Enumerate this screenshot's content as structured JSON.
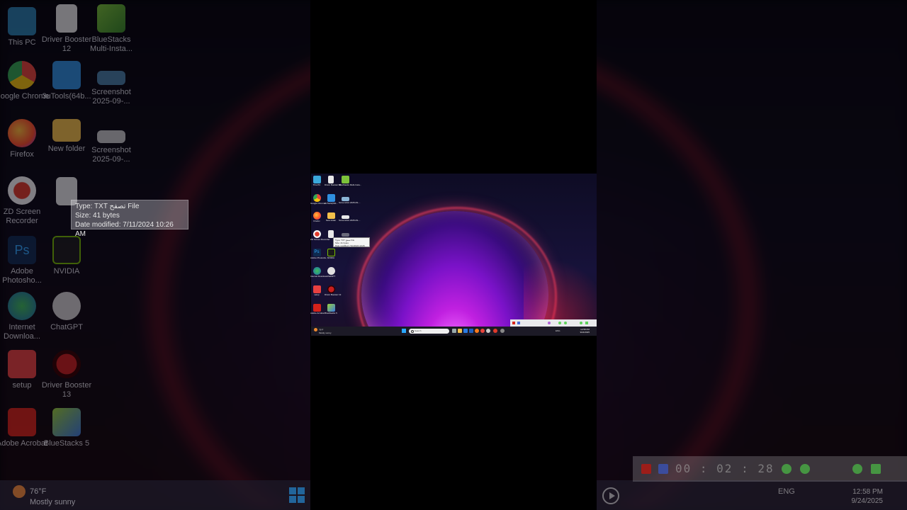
{
  "desktop_icons": [
    {
      "label": "This PC",
      "icon": "monitor-icon",
      "color": "#3aa7d8"
    },
    {
      "label": "Driver Booster 12",
      "icon": "file-icon",
      "color": "#e8e8e8"
    },
    {
      "label": "BlueStacks Multi-Insta...",
      "icon": "bluestacks-icon",
      "color": "#7cc23a"
    },
    {
      "label": "Google Chrome",
      "icon": "chrome-icon",
      "color": "#e8453c"
    },
    {
      "label": "3uTools(64b...",
      "icon": "3utools-icon",
      "color": "#2f8fe0"
    },
    {
      "label": "Screenshot 2025-09-...",
      "icon": "image-icon",
      "color": "#8ab4d6"
    },
    {
      "label": "Firefox",
      "icon": "firefox-icon",
      "color": "#ff7a1a"
    },
    {
      "label": "New folder",
      "icon": "folder-icon",
      "color": "#f3c04a"
    },
    {
      "label": "Screenshot 2025-09-...",
      "icon": "image-icon",
      "color": "#c8c8c8"
    },
    {
      "label": "ZD Screen Recorder",
      "icon": "recorder-icon",
      "color": "#e03a2a"
    },
    {
      "label": "",
      "icon": "file-icon",
      "color": "#e8e8e8"
    },
    {
      "label": "",
      "icon": "image-icon",
      "color": "#6a6a7a"
    },
    {
      "label": "Adobe Photosho...",
      "icon": "photoshop-icon",
      "color": "#0e2a4f"
    },
    {
      "label": "NVIDIA",
      "icon": "nvidia-icon",
      "color": "#76b900"
    },
    {
      "label": "Internet Downloa...",
      "icon": "idm-icon",
      "color": "#2da44e"
    },
    {
      "label": "ChatGPT",
      "icon": "chatgpt-icon",
      "color": "#d0d0d0"
    },
    {
      "label": "setup",
      "icon": "setup-icon",
      "color": "#e84040"
    },
    {
      "label": "Driver Booster 13",
      "icon": "driver-booster-icon",
      "color": "#c81e1e"
    },
    {
      "label": "Adobe Acrobat",
      "icon": "acrobat-icon",
      "color": "#d4221a"
    },
    {
      "label": "BlueStacks 5",
      "icon": "bluestacks-icon",
      "color": "#9ad13a"
    }
  ],
  "tooltip": {
    "type": "Type: TXT تصفح File",
    "size": "Size: 41 bytes",
    "modified": "Date modified: 7/11/2024 10:26 AM"
  },
  "taskbar": {
    "weather_temp": "76°F",
    "weather_desc": "Mostly sunny",
    "search_placeholder": "Search",
    "language": "ENG",
    "time": "12:58 PM",
    "date": "9/24/2025"
  },
  "recorder": {
    "timer": "00 : 02 : 28"
  },
  "colors": {
    "taskbar_bg": "#1c1a26",
    "accent": "#2aa8ff",
    "record_red": "#d8281e",
    "recorder_green": "#5fd35a"
  }
}
